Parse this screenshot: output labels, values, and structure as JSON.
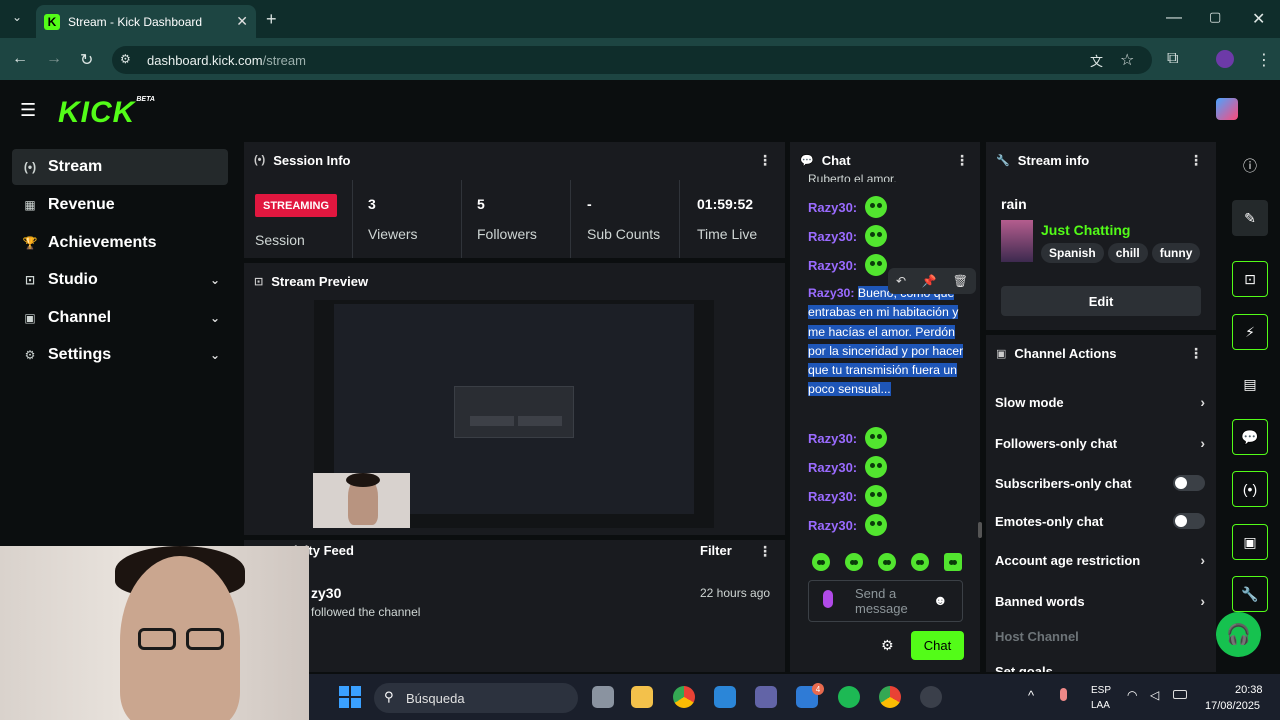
{
  "browser": {
    "tab_title": "Stream - Kick Dashboard",
    "url_host": "dashboard.kick.com",
    "url_path": "/stream"
  },
  "logo": {
    "text": "KICK",
    "badge": "BETA"
  },
  "sidebar": {
    "items": [
      {
        "label": "Stream",
        "icon": "broadcast-icon",
        "active": true
      },
      {
        "label": "Revenue",
        "icon": "revenue-icon"
      },
      {
        "label": "Achievements",
        "icon": "trophy-icon"
      },
      {
        "label": "Studio",
        "icon": "studio-icon",
        "expandable": true
      },
      {
        "label": "Channel",
        "icon": "channel-icon",
        "expandable": true
      },
      {
        "label": "Settings",
        "icon": "gear-icon",
        "expandable": true
      }
    ]
  },
  "session": {
    "title": "Session Info",
    "badge": "STREAMING",
    "session_label": "Session",
    "stats": [
      {
        "value": "3",
        "label": "Viewers"
      },
      {
        "value": "5",
        "label": "Followers"
      },
      {
        "value": "-",
        "label": "Sub Counts"
      },
      {
        "value": "01:59:52",
        "label": "Time Live"
      }
    ]
  },
  "preview": {
    "title": "Stream Preview"
  },
  "activity": {
    "title": "Activity Feed",
    "filter_label": "Filter",
    "entry_name": "zy30",
    "entry_text": "followed the channel",
    "entry_time": "22 hours ago"
  },
  "chat": {
    "title": "Chat",
    "top_partial": "Ruberto el amor.",
    "username": "Razy30:",
    "highlight_first_word": "Bueno,",
    "highlight_rest": " como que entrabas en mi habitación y me hacías el amor. Perdón por la sinceridad y por hacer que tu transmisión fuera un poco sensual...",
    "send_placeholder": "Send a message",
    "chat_button": "Chat"
  },
  "stream_info": {
    "title": "Stream info",
    "stream_title": "rain",
    "category": "Just Chatting",
    "tags": [
      "Spanish",
      "chill",
      "funny"
    ],
    "edit_label": "Edit"
  },
  "channel_actions": {
    "title": "Channel Actions",
    "items": [
      {
        "label": "Slow mode",
        "kind": "arrow"
      },
      {
        "label": "Followers-only chat",
        "kind": "arrow"
      },
      {
        "label": "Subscribers-only chat",
        "kind": "toggle"
      },
      {
        "label": "Emotes-only chat",
        "kind": "toggle"
      },
      {
        "label": "Account age restriction",
        "kind": "arrow"
      },
      {
        "label": "Banned words",
        "kind": "arrow"
      }
    ],
    "host_channel": "Host Channel",
    "set_goals": "Set goals"
  },
  "taskbar": {
    "search_label": "Búsqueda",
    "lang_top": "ESP",
    "lang_bottom": "LAA",
    "time": "20:38",
    "date": "17/08/2025",
    "teams_badge": "4"
  },
  "colors": {
    "kick_green": "#53fc18",
    "streaming_red": "#e1173f",
    "chat_username": "#9a6bff",
    "selection_blue": "#1e56b8"
  }
}
